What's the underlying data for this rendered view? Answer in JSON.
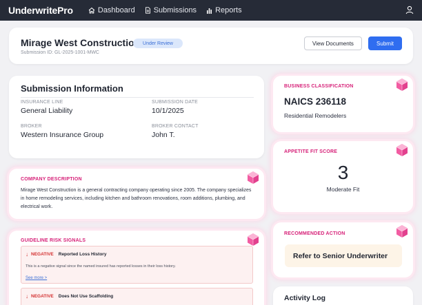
{
  "app": {
    "name": "UnderwritePro"
  },
  "nav": {
    "items": [
      {
        "label": "Dashboard"
      },
      {
        "label": "Submissions"
      },
      {
        "label": "Reports"
      }
    ]
  },
  "header": {
    "company": "Mirage West Construction",
    "submission_id": "Submission ID: GL-2025-1001-MWC",
    "status": "Under Review",
    "view_documents": "View Documents",
    "submit": "Submit"
  },
  "submission_info": {
    "title": "Submission Information",
    "insurance_line_label": "INSURANCE LINE",
    "insurance_line": "General Liability",
    "submission_date_label": "SUBMISSION DATE",
    "submission_date": "10/1/2025",
    "broker_label": "BROKER",
    "broker": "Western Insurance Group",
    "broker_contact_label": "BROKER CONTACT",
    "broker_contact": "John T."
  },
  "company_description": {
    "title": "COMPANY DESCRIPTION",
    "text": "Mirage West Construction is a general contracting company operating since 2005. The company specializes in home remodeling services, including kitchen and bathroom renovations, room additions, plumbing, and electrical work."
  },
  "risk_signals": {
    "title": "GUIDELINE RISK SIGNALS",
    "items": [
      {
        "type": "NEGATIVE",
        "title": "Reported Loss History",
        "description": "This is a negative signal since the named insured has reported losses in their loss history.",
        "more": "See more >"
      },
      {
        "type": "NEGATIVE",
        "title": "Does Not Use Scaffolding"
      }
    ]
  },
  "business_classification": {
    "title": "BUSINESS CLASSIFICATION",
    "code": "NAICS 236118",
    "description": "Residential Remodelers"
  },
  "appetite": {
    "title": "APPETITE FIT SCORE",
    "score": "3",
    "label": "Moderate Fit"
  },
  "recommended_action": {
    "title": "RECOMMENDED ACTION",
    "action": "Refer to Senior Underwriter"
  },
  "activity_log": {
    "title": "Activity Log"
  },
  "colors": {
    "accent": "#d61f77",
    "primary": "#2f6df0",
    "nav_bg": "#262b37",
    "negative": "#d43030"
  }
}
